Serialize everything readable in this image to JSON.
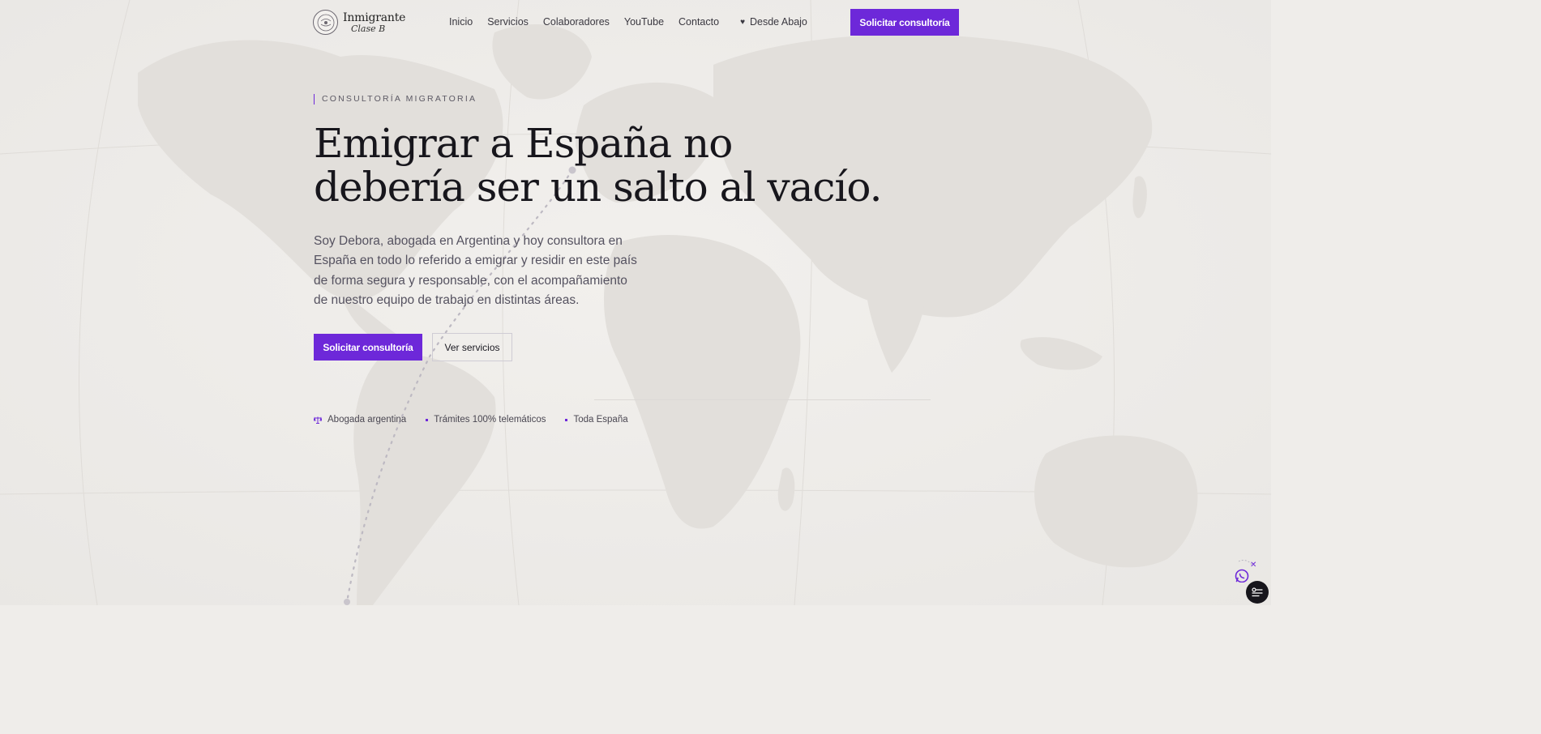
{
  "brand": {
    "name_main": "Inmigrante",
    "name_sub": "Clase B"
  },
  "nav": {
    "items": [
      "Inicio",
      "Servicios",
      "Colaboradores",
      "YouTube",
      "Contacto"
    ],
    "special": "Desde Abajo",
    "special_icon": "heart-icon",
    "cta": "Solicitar consultoría"
  },
  "hero": {
    "eyebrow": "CONSULTORÍA MIGRATORIA",
    "headline_line1": "Emigrar a España no",
    "headline_line2": "debería ser un salto al vacío.",
    "description": "Soy Debora, abogada en Argentina y hoy consultora en España en todo lo referido a emigrar y residir en este país de forma segura y responsable, con el acompañamiento de nuestro equipo de trabajo en distintas áreas.",
    "cta_primary": "Solicitar consultoría",
    "cta_secondary": "Ver servicios",
    "features": [
      {
        "icon": "scale-icon",
        "label": "Abogada argentina"
      },
      {
        "icon": "dot",
        "label": "Trámites 100% telemáticos"
      },
      {
        "icon": "dot",
        "label": "Toda España"
      }
    ]
  },
  "widgets": {
    "whatsapp_icon": "whatsapp-icon",
    "cookie_icon": "cookie-settings-icon"
  },
  "colors": {
    "accent": "#6d28d9",
    "background": "#efedea",
    "text": "#17161c"
  }
}
